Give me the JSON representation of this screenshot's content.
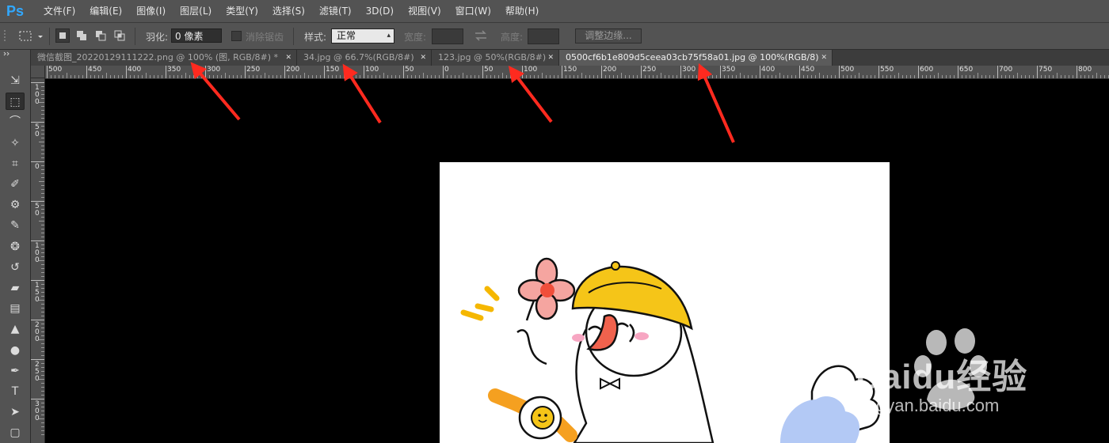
{
  "app": {
    "logo": "Ps"
  },
  "menu": [
    "文件(F)",
    "编辑(E)",
    "图像(I)",
    "图层(L)",
    "类型(Y)",
    "选择(S)",
    "滤镜(T)",
    "3D(D)",
    "视图(V)",
    "窗口(W)",
    "帮助(H)"
  ],
  "options": {
    "feather_label": "羽化:",
    "feather_value": "0 像素",
    "antialias_label": "消除锯齿",
    "style_label": "样式:",
    "style_value": "正常",
    "width_label": "宽度:",
    "height_label": "高度:",
    "refine_edge": "调整边缘..."
  },
  "tabs": [
    {
      "label": "微信截图_20220129111222.png @ 100% (图, RGB/8#) *",
      "active": false
    },
    {
      "label": "34.jpg @ 66.7%(RGB/8#)",
      "active": false
    },
    {
      "label": "123.jpg @ 50%(RGB/8#)",
      "active": false
    },
    {
      "label": "0500cf6b1e809d5ceea03cb75f58a01.jpg @ 100%(RGB/8)",
      "active": true
    }
  ],
  "tools": [
    "move-tool",
    "marquee-tool",
    "lasso-tool",
    "magic-wand-tool",
    "crop-tool",
    "eyedropper-tool",
    "spot-healing-tool",
    "brush-tool",
    "clone-stamp-tool",
    "history-brush-tool",
    "eraser-tool",
    "gradient-tool",
    "blur-tool",
    "dodge-tool",
    "pen-tool",
    "type-tool",
    "path-selection-tool",
    "shape-tool"
  ],
  "ruler": {
    "h_labels": [
      "500",
      "450",
      "400",
      "350",
      "300",
      "250",
      "200",
      "150",
      "100",
      "50",
      "0",
      "50",
      "100",
      "150",
      "200",
      "250",
      "300",
      "350",
      "400",
      "450",
      "500",
      "550",
      "600",
      "650",
      "700",
      "750",
      "800"
    ],
    "v_labels": [
      "100",
      "50",
      "0",
      "50",
      "100",
      "150",
      "200",
      "250",
      "300"
    ]
  },
  "watermark": {
    "brand": "Baidu经验",
    "url": "jingyan.baidu.com"
  },
  "colors": {
    "arrow": "#ff2a1f",
    "ui_bg": "#535353",
    "canvas": "#000000",
    "doc": "#ffffff",
    "accent": "#31a8ff"
  }
}
